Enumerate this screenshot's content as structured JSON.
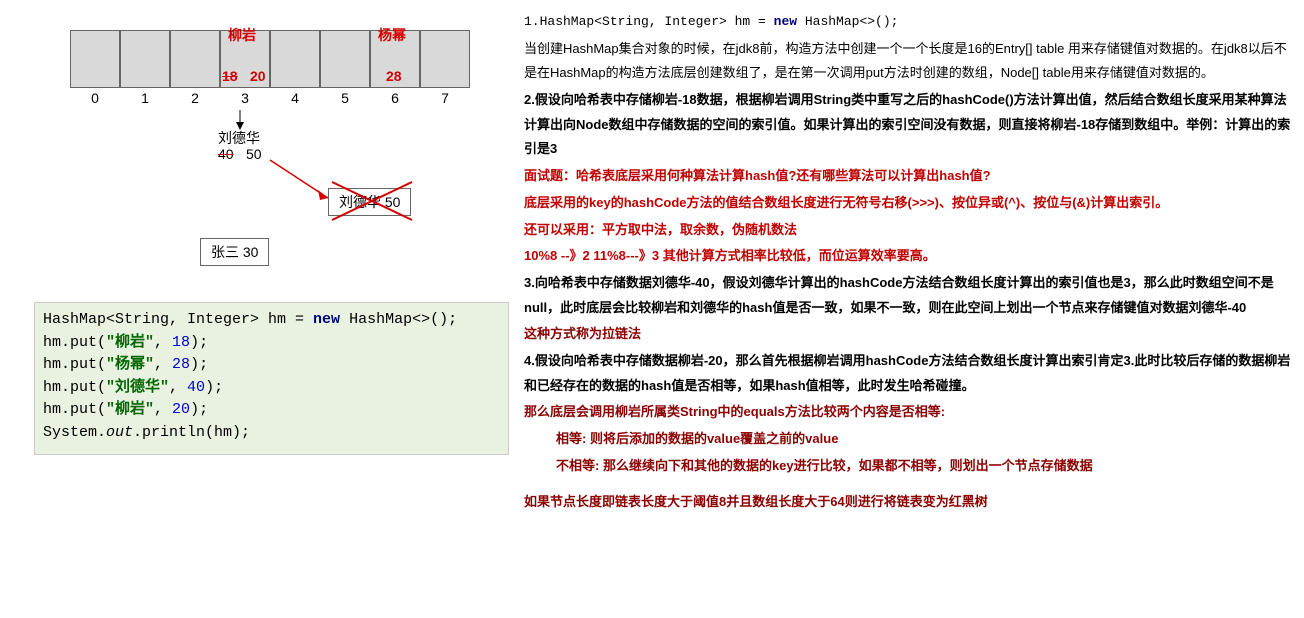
{
  "diagram": {
    "axis": [
      "0",
      "1",
      "2",
      "3",
      "4",
      "5",
      "6",
      "7"
    ],
    "cell3_name": "柳岩",
    "cell3_old": "18",
    "cell3_new": "20",
    "cell6_name": "杨幂",
    "cell6_val": "28",
    "below3_name": "刘德华",
    "below3_old": "40",
    "below3_new": "50",
    "box_liudehua": "刘德华 50",
    "box_zhangsan": "张三 30"
  },
  "code": {
    "l1a": "HashMap<String, Integer> hm = ",
    "l1b": "new",
    "l1c": " HashMap<>();",
    "l2a": "hm.put(",
    "l2s": "\"柳岩\"",
    "l2b": ", ",
    "l2n": "18",
    "l2c": ");",
    "l3s": "\"杨幂\"",
    "l3n": "28",
    "l4s": "\"刘德华\"",
    "l4n": "40",
    "l5s": "\"柳岩\"",
    "l5n": "20",
    "l6a": "System.",
    "l6b": "out",
    "l6c": ".println(hm);"
  },
  "right": {
    "p1a": "1.HashMap<String, Integer> hm = ",
    "p1b": "new",
    "p1c": " HashMap<>();",
    "p2": "当创建HashMap集合对象的时候，在jdk8前，构造方法中创建一个一个长度是16的Entry[] table 用来存储键值对数据的。在jdk8以后不是在HashMap的构造方法底层创建数组了，是在第一次调用put方法时创建的数组，Node[] table用来存储键值对数据的。",
    "p3": "2.假设向哈希表中存储柳岩-18数据，根据柳岩调用String类中重写之后的hashCode()方法计算出值，然后结合数组长度采用某种算法计算出向Node数组中存储数据的空间的索引值。如果计算出的索引空间没有数据，则直接将柳岩-18存储到数组中。举例：计算出的索引是3",
    "p4": "面试题：哈希表底层采用何种算法计算hash值?还有哪些算法可以计算出hash值?",
    "p5": "底层采用的key的hashCode方法的值结合数组长度进行无符号右移(>>>)、按位异或(^)、按位与(&)计算出索引。",
    "p6": "还可以采用：平方取中法，取余数，伪随机数法",
    "p7": "10%8 --》2  11%8---》3 其他计算方式相率比较低，而位运算效率要高。",
    "p8": "3.向哈希表中存储数据刘德华-40，假设刘德华计算出的hashCode方法结合数组长度计算出的索引值也是3，那么此时数组空间不是null，此时底层会比较柳岩和刘德华的hash值是否一致，如果不一致，则在此空间上划出一个节点来存储键值对数据刘德华-40",
    "p9": "这种方式称为拉链法",
    "p10": "4.假设向哈希表中存储数据柳岩-20，那么首先根据柳岩调用hashCode方法结合数组长度计算出索引肯定3.此时比较后存储的数据柳岩和已经存在的数据的hash值是否相等，如果hash值相等，此时发生哈希碰撞。",
    "p11": "那么底层会调用柳岩所属类String中的equals方法比较两个内容是否相等:",
    "p12": "相等: 则将后添加的数据的value覆盖之前的value",
    "p13": "不相等: 那么继续向下和其他的数据的key进行比较，如果都不相等，则划出一个节点存储数据",
    "p14": "如果节点长度即链表长度大于阈值8并且数组长度大于64则进行将链表变为红黑树"
  }
}
